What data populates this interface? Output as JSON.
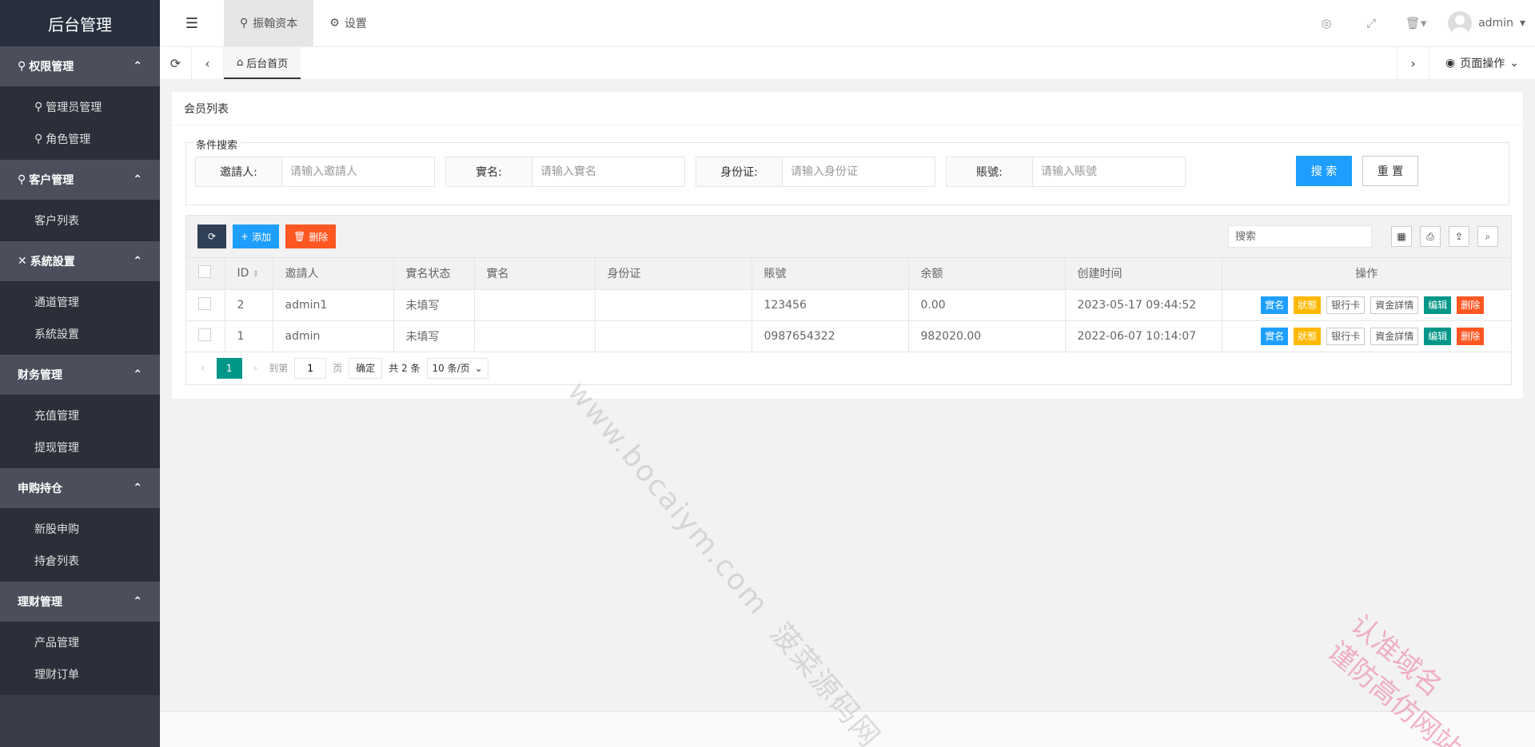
{
  "app_title": "后台管理",
  "sidebar": {
    "groups": [
      {
        "label": "权限管理",
        "icon": "user-icon",
        "items": [
          "管理员管理",
          "角色管理"
        ]
      },
      {
        "label": "客户管理",
        "icon": "user-icon",
        "items": [
          "客户列表"
        ]
      },
      {
        "label": "系統設置",
        "icon": "tools-icon",
        "items": [
          "通道管理",
          "系統設置"
        ]
      },
      {
        "label": "财务管理",
        "icon": "",
        "items": [
          "充值管理",
          "提现管理"
        ]
      },
      {
        "label": "申购持仓",
        "icon": "",
        "items": [
          "新股申购",
          "持倉列表"
        ]
      },
      {
        "label": "理财管理",
        "icon": "",
        "items": [
          "产品管理",
          "理财订单"
        ]
      }
    ]
  },
  "header": {
    "tabs": [
      {
        "label": "振翰资本",
        "active": true
      },
      {
        "label": "设置",
        "active": false
      }
    ],
    "user": "admin"
  },
  "tabsbar": {
    "home_tab": "后台首页",
    "page_ops": "页面操作"
  },
  "card": {
    "title": "会员列表",
    "search": {
      "legend": "条件搜索",
      "fields": [
        {
          "label": "邀請人:",
          "placeholder": "请输入邀請人"
        },
        {
          "label": "實名:",
          "placeholder": "请输入實名"
        },
        {
          "label": "身份证:",
          "placeholder": "请输入身份证"
        },
        {
          "label": "賬號:",
          "placeholder": "请输入賬號"
        }
      ],
      "search_btn": "搜 索",
      "reset_btn": "重 置"
    },
    "toolbar": {
      "add": "添加",
      "delete": "删除",
      "search_placeholder": "搜索"
    },
    "table": {
      "columns": [
        "ID",
        "邀請人",
        "實名状态",
        "實名",
        "身份证",
        "賬號",
        "余额",
        "创建时间",
        "操作"
      ],
      "rows": [
        {
          "id": "2",
          "inviter": "admin1",
          "status": "未填写",
          "name": "",
          "idcard": "",
          "account": "123456",
          "balance": "0.00",
          "created": "2023-05-17 09:44:52"
        },
        {
          "id": "1",
          "inviter": "admin",
          "status": "未填写",
          "name": "",
          "idcard": "",
          "account": "0987654322",
          "balance": "982020.00",
          "created": "2022-06-07 10:14:07"
        }
      ],
      "row_actions": [
        "實名",
        "狀態",
        "银行卡",
        "資金詳情",
        "编辑",
        "删除"
      ]
    },
    "pager": {
      "current": "1",
      "goto_label": "到第",
      "goto_value": "1",
      "page_unit": "页",
      "confirm": "确定",
      "total": "共 2 条",
      "page_size": "10 条/页"
    }
  },
  "watermarks": {
    "site": "www.bocaiym.com",
    "brand": "菠菜源码网",
    "notice_line1": "认准域名",
    "notice_line2": "谨防高仿网站"
  },
  "colors": {
    "sidebar_bg": "#393d49",
    "primary_blue": "#1e9fff",
    "danger_orange": "#ff5722",
    "teal": "#009688",
    "warn_yellow": "#ffb800"
  }
}
